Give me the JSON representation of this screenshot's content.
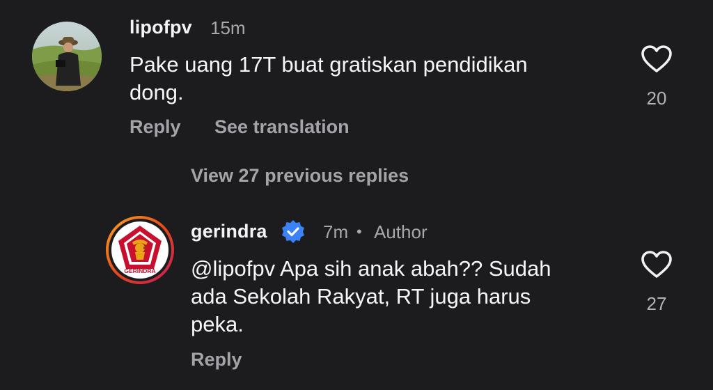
{
  "comments": [
    {
      "username": "lipofpv",
      "time": "15m",
      "text": "Pake uang 17T buat gratiskan pendidikan\ndong.",
      "reply_label": "Reply",
      "translate_label": "See translation",
      "likes": "20"
    }
  ],
  "thread": {
    "view_replies_label": "View 27 previous replies"
  },
  "reply": {
    "username": "gerindra",
    "time": "7m",
    "separator": "•",
    "author_badge": "Author",
    "mention": "@lipofpv",
    "text": "@lipofpv Apa sih anak abah?? Sudah\nada Sekolah Rakyat, RT juga harus\npeka.",
    "reply_label": "Reply",
    "likes": "27",
    "avatar_logo_text": "GERINDRA"
  },
  "colors": {
    "background": "#1c1c1f",
    "verified": "#3b82f6",
    "story_ring_start": "#f9a825",
    "story_ring_end": "#c2185b"
  },
  "icons": {
    "like": "heart-outline-icon",
    "verified": "verified-badge-icon"
  }
}
